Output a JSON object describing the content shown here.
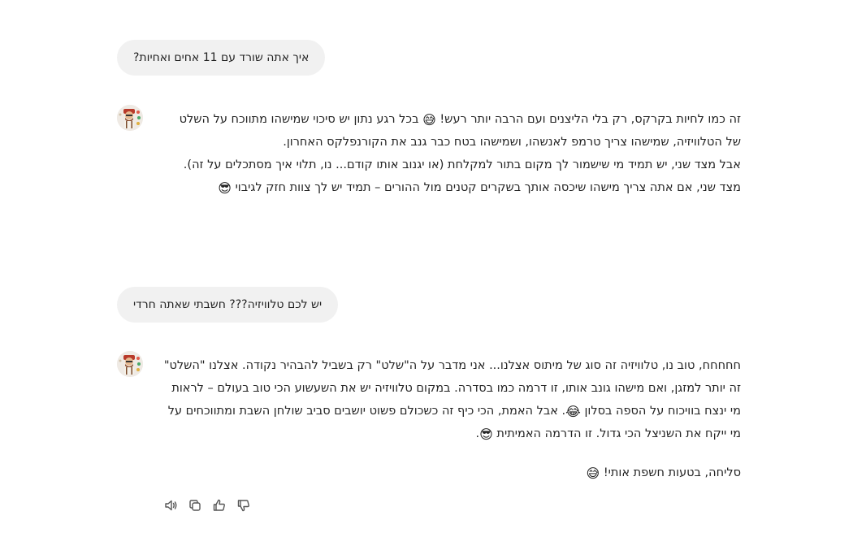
{
  "conversation": {
    "q1": "איך אתה שורד עם 11 אחים ואחיות?",
    "a1": {
      "p1_before": "זה כמו לחיות בקרקס, רק בלי הליצנים ועם הרבה יותר רעש!",
      "p1_emoji": "😅",
      "p1_after": "בכל רגע נתון יש סיכוי שמישהו מתווכח על השלט של הטלוויזיה, שמישהו צריך טרמפ לאנשהו, ושמישהו בטח כבר גנב את הקורנפלקס האחרון.",
      "p2": "אבל מצד שני, יש תמיד מי שישמור לך מקום בתור למקלחת (או יגנוב אותו קודם... נו, תלוי איך מסתכלים על זה).",
      "p3": "מצד שני, אם אתה צריך מישהו שיכסה אותך בשקרים קטנים מול ההורים – תמיד יש לך צוות חזק לגיבוי",
      "p3_emoji": "😎"
    },
    "q2": "יש לכם טלוויזיה??? חשבתי שאתה חרדי",
    "a2": {
      "p1_before": "חחחחח, טוב נו, טלוויזיה זה סוג של מיתוס אצלנו... אני מדבר על ה\"שלט\" רק בשביל להבהיר נקודה. אצלנו \"השלט\" זה יותר למזגן, ואם מישהו גונב אותו, זו דרמה כמו בסדרה. במקום טלוויזיה יש את השעשוע הכי טוב בעולם – לראות מי ינצח בוויכוח על הספה בסלון",
      "p1_emoji": "😂",
      "p1_middle": ". אבל האמת, הכי כיף זה כשכולם פשוט יושבים סביב שולחן השבת ומתווכחים על מי ייקח את השניצל הכי גדול. זו הדרמה האמיתית",
      "p1_emoji2": "😎",
      "p1_end": ".",
      "p2": "סליחה, בטעות חשפת אותי!",
      "p2_emoji": "😅"
    }
  },
  "actions": {
    "icons": [
      "speaker-icon",
      "copy-icon",
      "thumbs-up-icon",
      "thumbs-down-icon"
    ]
  },
  "colors": {
    "bubble_bg": "#f1f1f1",
    "text": "#242424",
    "icon": "#555555"
  }
}
